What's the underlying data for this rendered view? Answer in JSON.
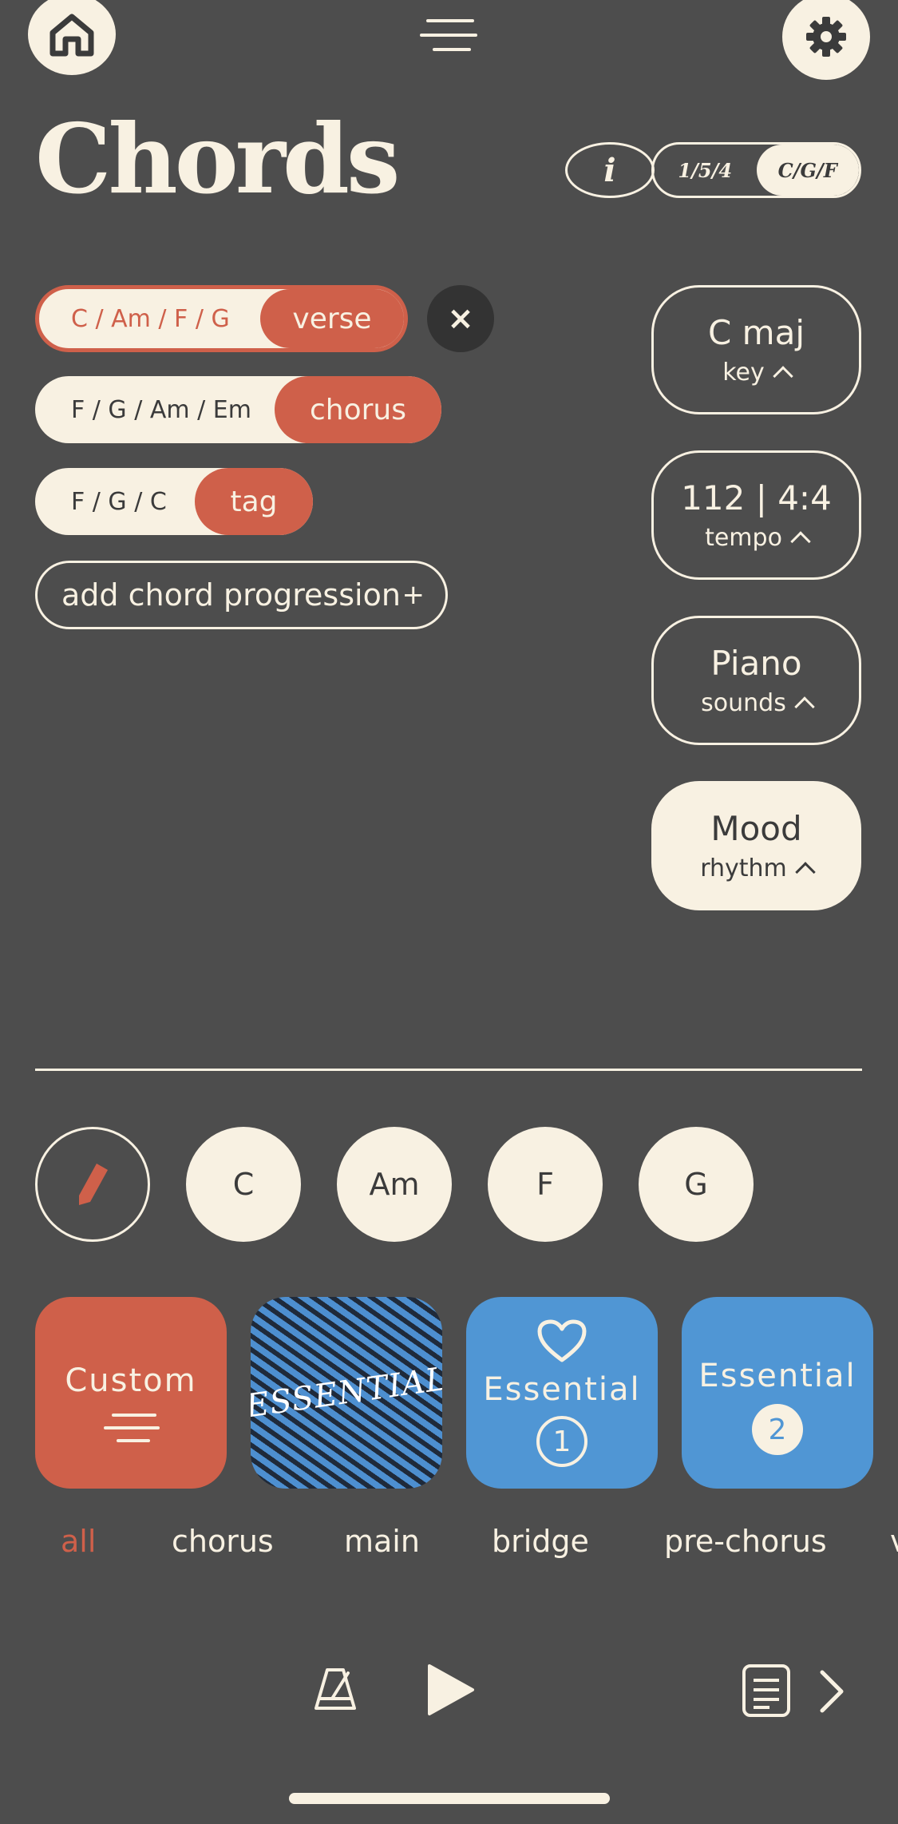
{
  "header": {
    "title": "Chords",
    "info_label": "i",
    "segment": {
      "options": [
        "1/5/4",
        "C/G/F"
      ],
      "active_index": 1
    }
  },
  "progressions": [
    {
      "chords": "C / Am / F / G",
      "section": "verse",
      "selected": true
    },
    {
      "chords": "F / G / Am / Em",
      "section": "chorus",
      "selected": false
    },
    {
      "chords": "F / G / C",
      "section": "tag",
      "selected": false
    }
  ],
  "remove_label": "×",
  "add_progression_label": "add chord progression",
  "add_icon": "+",
  "settings": [
    {
      "value": "C maj",
      "label": "key"
    },
    {
      "value": "112 | 4:4",
      "label": "tempo"
    },
    {
      "value": "Piano",
      "label": "sounds"
    },
    {
      "value": "Mood",
      "label": "rhythm"
    }
  ],
  "chord_buttons": [
    "C",
    "Am",
    "F",
    "G"
  ],
  "packs": [
    {
      "label": "Custom",
      "style": "red",
      "icon": "menu-lines-icon"
    },
    {
      "label": "ESSENTIAL",
      "style": "wavy"
    },
    {
      "label": "Essential",
      "style": "blue",
      "badge": "1",
      "icon": "heart-icon"
    },
    {
      "label": "Essential",
      "style": "blue",
      "badge": "2"
    }
  ],
  "tabs": [
    "all",
    "chorus",
    "main",
    "bridge",
    "pre-chorus",
    "v"
  ],
  "active_tab": "all",
  "colors": {
    "background": "#4d4d4d",
    "cream": "#f8f1e2",
    "accent": "#cf604a",
    "blue": "#5096d4"
  }
}
